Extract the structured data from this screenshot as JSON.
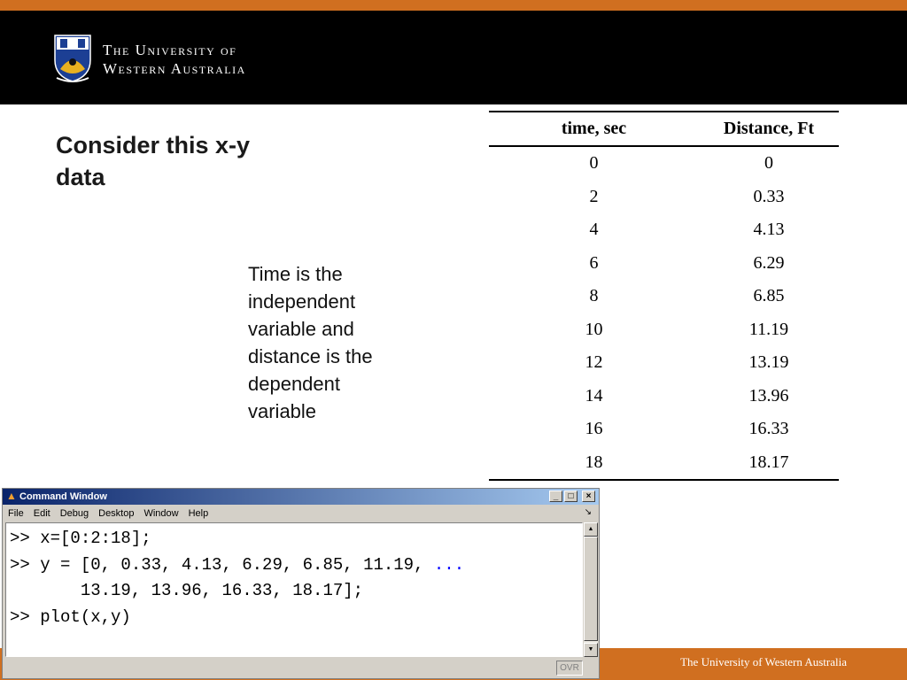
{
  "header": {
    "university_line1": "The University of",
    "university_line2": "Western Australia"
  },
  "slide": {
    "title": "Consider this x-y data",
    "note": "Time is the independent variable and distance is the dependent variable"
  },
  "table": {
    "headers": [
      "time, sec",
      "Distance, Ft"
    ],
    "rows": [
      [
        "0",
        "0"
      ],
      [
        "2",
        "0.33"
      ],
      [
        "4",
        "4.13"
      ],
      [
        "6",
        "6.29"
      ],
      [
        "8",
        "6.85"
      ],
      [
        "10",
        "11.19"
      ],
      [
        "12",
        "13.19"
      ],
      [
        "14",
        "13.96"
      ],
      [
        "16",
        "16.33"
      ],
      [
        "18",
        "18.17"
      ]
    ]
  },
  "command_window": {
    "title": "Command Window",
    "menu": [
      "File",
      "Edit",
      "Debug",
      "Desktop",
      "Window",
      "Help"
    ],
    "lines": [
      ">> x=[0:2:18];",
      ">> y = [0, 0.33, 4.13, 6.29, 6.85, 11.19, ",
      "       13.19, 13.96, 16.33, 18.17];",
      ">> plot(x,y)"
    ],
    "continuation": "...",
    "status_ovr": "OVR"
  },
  "footer": {
    "text": "The University of Western Australia"
  },
  "colors": {
    "accent_orange": "#d06f20",
    "header_black": "#000000",
    "title_bar_blue": "#0a246a"
  }
}
